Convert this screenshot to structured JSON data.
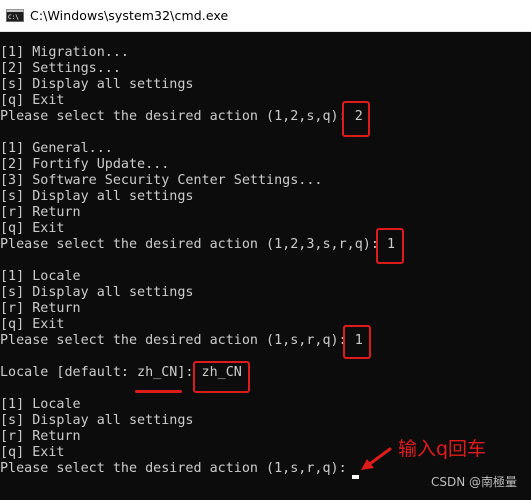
{
  "window": {
    "title": "C:\\Windows\\system32\\cmd.exe",
    "icon": "cmd-icon"
  },
  "console": {
    "lines": [
      "[1] Migration...",
      "[2] Settings...",
      "[s] Display all settings",
      "[q] Exit",
      "Please select the desired action (1,2,s,q): 2",
      "",
      "[1] General...",
      "[2] Fortify Update...",
      "[3] Software Security Center Settings...",
      "[s] Display all settings",
      "[r] Return",
      "[q] Exit",
      "Please select the desired action (1,2,3,s,r,q): 1",
      "",
      "[1] Locale",
      "[s] Display all settings",
      "[r] Return",
      "[q] Exit",
      "Please select the desired action (1,s,r,q): 1",
      "",
      "Locale [default: zh_CN]: zh_CN",
      "",
      "[1] Locale",
      "[s] Display all settings",
      "[r] Return",
      "[q] Exit",
      "Please select the desired action (1,s,r,q): "
    ]
  },
  "annotations": {
    "hint": "输入q回车",
    "color": "#e01b1b"
  },
  "watermark": "CSDN @南極量",
  "colors": {
    "console_bg": "#0c0c0c",
    "console_text": "#cccccc",
    "titlebar_bg": "#ffffff",
    "annotation_red": "#e01b1b"
  }
}
